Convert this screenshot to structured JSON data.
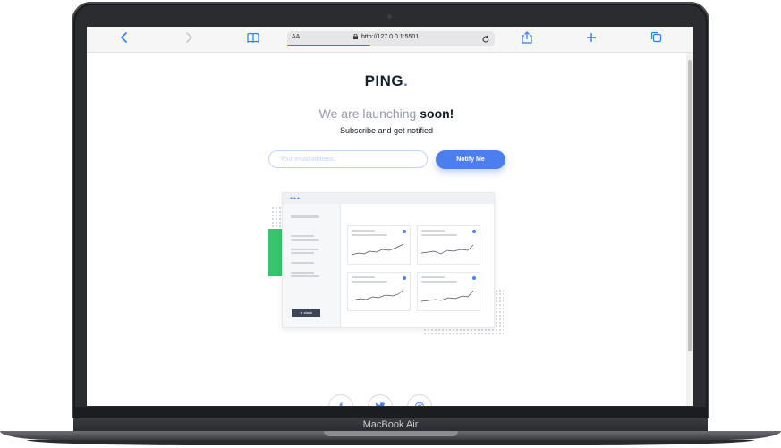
{
  "device": {
    "label": "MacBook Air"
  },
  "browser": {
    "url": "http://127.0.0.1:5501",
    "reader_label": "AA",
    "icons": {
      "back": "chevron-left-icon",
      "forward": "chevron-right-icon",
      "bookmarks": "book-icon",
      "reload": "reload-icon",
      "share": "share-icon",
      "new_tab": "plus-icon",
      "tabs": "tabs-icon"
    }
  },
  "page": {
    "logo": "PING",
    "logo_dot": ".",
    "headline_light": "We are launching",
    "headline_bold": "soon!",
    "subheading": "Subscribe and get notified",
    "email_placeholder": "Your email address...",
    "notify_label": "Notify Me",
    "illustration": {
      "sidebar_button": "★ stack"
    },
    "social": [
      {
        "name": "facebook",
        "glyph": "f"
      },
      {
        "name": "twitter",
        "glyph": "✉"
      },
      {
        "name": "instagram",
        "glyph": "◎"
      }
    ]
  },
  "colors": {
    "accent": "#4c7ef0",
    "dark": "#121725",
    "muted": "#969aa3",
    "green": "#38c46d"
  }
}
